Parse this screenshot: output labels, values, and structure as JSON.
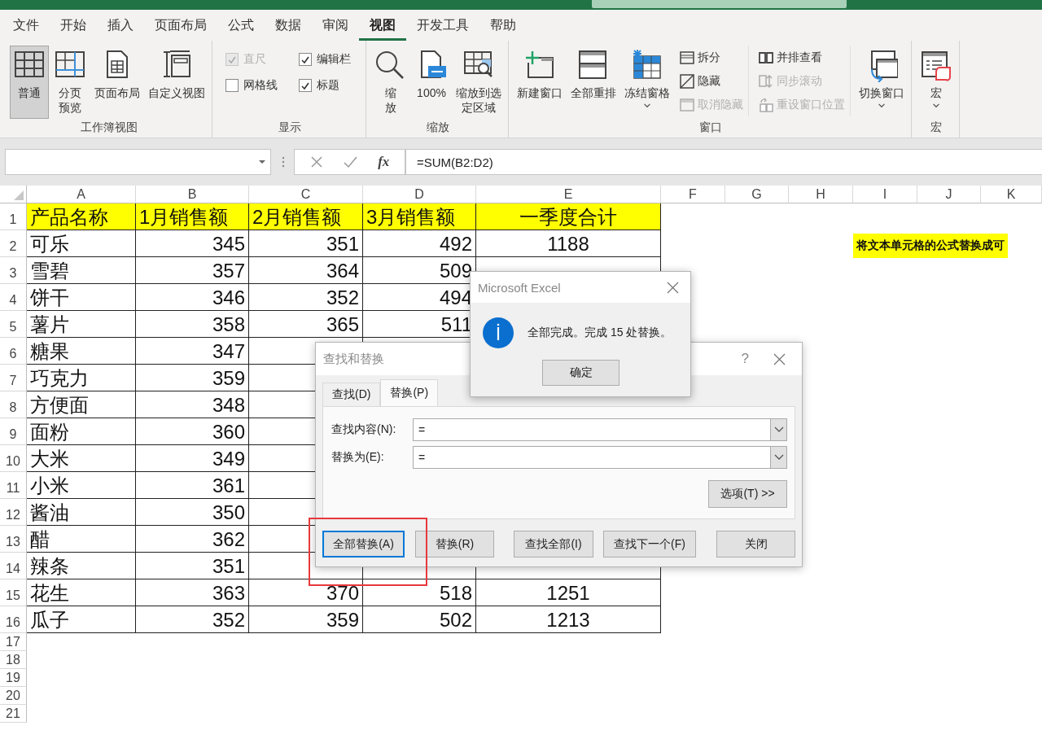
{
  "menu_tabs": [
    {
      "label": "文件",
      "selected": false
    },
    {
      "label": "开始",
      "selected": false
    },
    {
      "label": "插入",
      "selected": false
    },
    {
      "label": "页面布局",
      "selected": false
    },
    {
      "label": "公式",
      "selected": false
    },
    {
      "label": "数据",
      "selected": false
    },
    {
      "label": "审阅",
      "selected": false
    },
    {
      "label": "视图",
      "selected": true
    },
    {
      "label": "开发工具",
      "selected": false
    },
    {
      "label": "帮助",
      "selected": false
    }
  ],
  "ribbon": {
    "groups": [
      {
        "label": "工作簿视图",
        "items": [
          {
            "kind": "large",
            "label": "普通",
            "selected": true
          },
          {
            "kind": "large",
            "label": "分页预览",
            "selected": false
          },
          {
            "kind": "large",
            "label": "页面布局",
            "selected": false
          },
          {
            "kind": "large",
            "label": "自定义视图",
            "selected": false
          }
        ]
      },
      {
        "label": "显示",
        "items": [
          {
            "kind": "stack",
            "items": [
              {
                "kind": "check",
                "label": "直尺",
                "checked": true,
                "disabled": true
              },
              {
                "kind": "check",
                "label": "网格线",
                "checked": false,
                "disabled": false
              }
            ]
          },
          {
            "kind": "stack",
            "items": [
              {
                "kind": "check",
                "label": "编辑栏",
                "checked": true,
                "disabled": false
              },
              {
                "kind": "check",
                "label": "标题",
                "checked": true,
                "disabled": false
              }
            ]
          }
        ]
      },
      {
        "label": "缩放",
        "items": [
          {
            "kind": "large",
            "label": "缩放"
          },
          {
            "kind": "large",
            "label": "100%"
          },
          {
            "kind": "large",
            "label": "缩放到选定区域"
          }
        ]
      },
      {
        "label": "窗口",
        "items": [
          {
            "kind": "large",
            "label": "新建窗口"
          },
          {
            "kind": "large",
            "label": "全部重排"
          },
          {
            "kind": "large",
            "label": "冻结窗格",
            "dropdown": true
          },
          {
            "kind": "stack",
            "items": [
              {
                "kind": "small",
                "label": "拆分",
                "disabled": false
              },
              {
                "kind": "small",
                "label": "隐藏",
                "disabled": false
              },
              {
                "kind": "small",
                "label": "取消隐藏",
                "disabled": true
              }
            ]
          },
          {
            "kind": "stack",
            "items": [
              {
                "kind": "small",
                "label": "并排查看",
                "disabled": false
              },
              {
                "kind": "small",
                "label": "同步滚动",
                "disabled": true
              },
              {
                "kind": "small",
                "label": "重设窗口位置",
                "disabled": true
              }
            ]
          },
          {
            "kind": "large",
            "label": "切换窗口",
            "dropdown": true
          }
        ]
      },
      {
        "label": "宏",
        "items": [
          {
            "kind": "large",
            "label": "宏",
            "dropdown": true
          }
        ]
      }
    ]
  },
  "formula_bar": {
    "function_label": "fx",
    "formula": "=SUM(B2:D2)"
  },
  "sheet": {
    "columns": [
      "A",
      "B",
      "C",
      "D",
      "E",
      "F",
      "G",
      "H",
      "I",
      "J",
      "K"
    ],
    "rows": [
      {
        "header": "1",
        "highlighted": true,
        "cells": [
          "产品名称",
          "1月销售额",
          "2月销售额",
          "3月销售额",
          "一季度合计"
        ]
      },
      {
        "header": "2",
        "highlighted": false,
        "cells": [
          "可乐",
          "345",
          "351",
          "492",
          "1188"
        ],
        "note": "将文本单元格的公式替换成可"
      },
      {
        "header": "3",
        "highlighted": false,
        "cells": [
          "雪碧",
          "357",
          "364",
          "509",
          null
        ]
      },
      {
        "header": "4",
        "highlighted": false,
        "cells": [
          "饼干",
          "346",
          "352",
          "494",
          null
        ]
      },
      {
        "header": "5",
        "highlighted": false,
        "cells": [
          "薯片",
          "358",
          "365",
          "511",
          null
        ]
      },
      {
        "header": "6",
        "highlighted": false,
        "cells": [
          "糖果",
          "347",
          null,
          null,
          null
        ]
      },
      {
        "header": "7",
        "highlighted": false,
        "cells": [
          "巧克力",
          "359",
          null,
          null,
          null
        ]
      },
      {
        "header": "8",
        "highlighted": false,
        "cells": [
          "方便面",
          "348",
          null,
          null,
          null
        ]
      },
      {
        "header": "9",
        "highlighted": false,
        "cells": [
          "面粉",
          "360",
          null,
          null,
          null
        ]
      },
      {
        "header": "10",
        "highlighted": false,
        "cells": [
          "大米",
          "349",
          null,
          null,
          null
        ]
      },
      {
        "header": "11",
        "highlighted": false,
        "cells": [
          "小米",
          "361",
          null,
          null,
          null
        ]
      },
      {
        "header": "12",
        "highlighted": false,
        "cells": [
          "酱油",
          "350",
          null,
          null,
          null
        ]
      },
      {
        "header": "13",
        "highlighted": false,
        "cells": [
          "醋",
          "362",
          null,
          null,
          null
        ]
      },
      {
        "header": "14",
        "highlighted": false,
        "cells": [
          "辣条",
          "351",
          null,
          null,
          null
        ]
      },
      {
        "header": "15",
        "highlighted": false,
        "cells": [
          "花生",
          "363",
          "370",
          "518",
          "1251"
        ]
      },
      {
        "header": "16",
        "highlighted": false,
        "cells": [
          "瓜子",
          "352",
          "359",
          "502",
          "1213"
        ]
      },
      {
        "header": "17"
      },
      {
        "header": "18"
      },
      {
        "header": "19"
      },
      {
        "header": "20"
      },
      {
        "header": "21"
      }
    ]
  },
  "find_replace_dialog": {
    "title": "查找和替换",
    "help": "?",
    "tabs": [
      {
        "label": "查找(D)",
        "selected": false
      },
      {
        "label": "替换(P)",
        "selected": true
      }
    ],
    "fields": [
      {
        "label": "查找内容(N):",
        "value": "="
      },
      {
        "label": "替换为(E):",
        "value": "="
      }
    ],
    "options_button": "选项(T) >>",
    "buttons": [
      {
        "label": "全部替换(A)",
        "focused": true
      },
      {
        "label": "替换(R)",
        "focused": false
      },
      {
        "label": "查找全部(I)",
        "focused": false
      },
      {
        "label": "查找下一个(F)",
        "focused": false
      },
      {
        "label": "关闭",
        "focused": false
      }
    ]
  },
  "message_box": {
    "title": "Microsoft Excel",
    "message": "全部完成。完成 15 处替换。",
    "button": "确定"
  },
  "annotation": {
    "kind": "rectangle"
  }
}
